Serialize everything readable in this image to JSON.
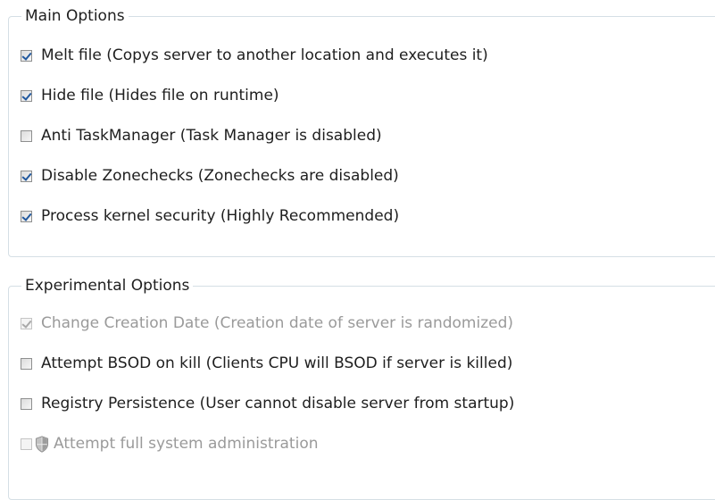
{
  "main_options": {
    "legend": "Main Options",
    "items": [
      {
        "label": "Melt file (Copys server to another location and executes it)",
        "checked": true,
        "enabled": true
      },
      {
        "label": "Hide file (Hides file on runtime)",
        "checked": true,
        "enabled": true
      },
      {
        "label": "Anti TaskManager (Task Manager is disabled)",
        "checked": false,
        "enabled": true
      },
      {
        "label": "Disable Zonechecks (Zonechecks are disabled)",
        "checked": true,
        "enabled": true
      },
      {
        "label": "Process kernel security (Highly Recommended)",
        "checked": true,
        "enabled": true
      }
    ]
  },
  "experimental_options": {
    "legend": "Experimental Options",
    "items": [
      {
        "label": "Change Creation Date (Creation date of server is randomized)",
        "checked": true,
        "enabled": false
      },
      {
        "label": "Attempt BSOD on kill (Clients CPU will BSOD if server is killed)",
        "checked": false,
        "enabled": true
      },
      {
        "label": "Registry Persistence (User cannot disable server from startup)",
        "checked": false,
        "enabled": true
      },
      {
        "label": "Attempt full system administration",
        "checked": false,
        "enabled": false,
        "icon": "uac-shield-icon"
      }
    ]
  }
}
